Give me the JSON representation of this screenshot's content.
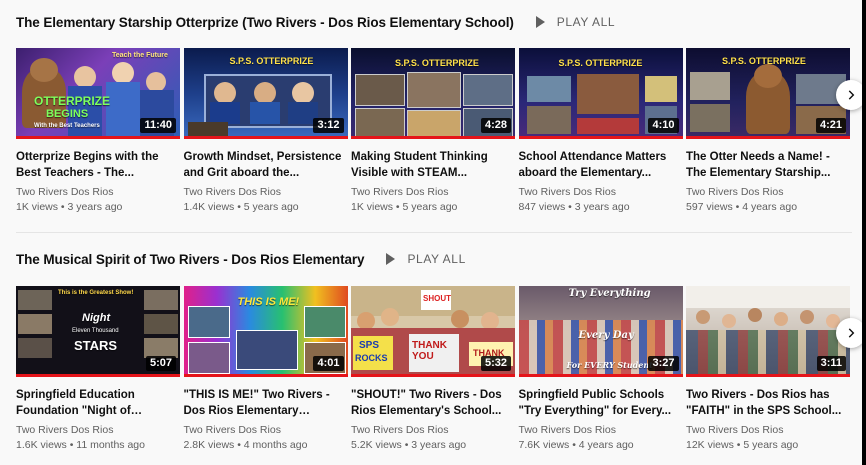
{
  "shelves": [
    {
      "title": "The Elementary Starship Otterprize (Two Rivers - Dos Rios Elementary School)",
      "play_all": "PLAY ALL",
      "videos": [
        {
          "title": "Otterprize Begins with the Best Teachers - The...",
          "channel": "Two Rivers Dos Rios",
          "meta": "1K views • 3 years ago",
          "duration": "11:40",
          "thumb_text": [
            "Teach the Future",
            "OTTERPRIZE",
            "BEGINS",
            "With the Best Teachers"
          ]
        },
        {
          "title": "Growth Mindset, Persistence and Grit aboard the...",
          "channel": "Two Rivers Dos Rios",
          "meta": "1.4K views • 5 years ago",
          "duration": "3:12",
          "thumb_text": [
            "S.P.S. OTTERPRIZE"
          ]
        },
        {
          "title": "Making Student Thinking Visible with STEAM...",
          "channel": "Two Rivers Dos Rios",
          "meta": "1K views • 5 years ago",
          "duration": "4:28",
          "thumb_text": [
            "S.P.S. OTTERPRIZE"
          ]
        },
        {
          "title": "School Attendance Matters aboard the Elementary...",
          "channel": "Two Rivers Dos Rios",
          "meta": "847 views • 3 years ago",
          "duration": "4:10",
          "thumb_text": [
            "S.P.S. OTTERPRIZE"
          ]
        },
        {
          "title": "The Otter Needs a Name! - The Elementary Starship...",
          "channel": "Two Rivers Dos Rios",
          "meta": "597 views • 4 years ago",
          "duration": "4:21",
          "thumb_text": [
            "S.P.S. OTTERPRIZE"
          ]
        }
      ]
    },
    {
      "title": "The Musical Spirit of Two Rivers - Dos Rios Elementary",
      "play_all": "PLAY ALL",
      "videos": [
        {
          "title": "Springfield Education Foundation \"Night of 11,000...",
          "channel": "Two Rivers Dos Rios",
          "meta": "1.6K views • 11 months ago",
          "duration": "5:07",
          "thumb_text": [
            "This is the Greatest Show!",
            "Night",
            "Eleven Thousand",
            "STARS"
          ]
        },
        {
          "title": "\"THIS IS ME!\" Two Rivers - Dos Rios Elementary School...",
          "channel": "Two Rivers Dos Rios",
          "meta": "2.8K views • 4 months ago",
          "duration": "4:01",
          "thumb_text": [
            "THIS IS ME!"
          ]
        },
        {
          "title": "\"SHOUT!\" Two Rivers - Dos Rios Elementary's School...",
          "channel": "Two Rivers Dos Rios",
          "meta": "5.2K views • 3 years ago",
          "duration": "5:32",
          "thumb_text": [
            "SHOUT",
            "SPS",
            "ROCKS",
            "THANK YOU",
            "THANK"
          ]
        },
        {
          "title": "Springfield Public Schools \"Try Everything\" for Every...",
          "channel": "Two Rivers Dos Rios",
          "meta": "7.6K views • 4 years ago",
          "duration": "3:27",
          "thumb_text": [
            "Try Everything",
            "Every Day",
            "For EVERY Student"
          ]
        },
        {
          "title": "Two Rivers - Dos Rios has \"FAITH\" in the SPS School...",
          "channel": "Two Rivers Dos Rios",
          "meta": "12K views • 5 years ago",
          "duration": "3:11",
          "thumb_text": []
        }
      ]
    }
  ],
  "icons": {
    "play": "play-icon",
    "next": "chevron-right-icon"
  },
  "colors": {
    "progress": "#e5141a",
    "background": "#f9f9f9",
    "secondary_text": "#606060"
  }
}
